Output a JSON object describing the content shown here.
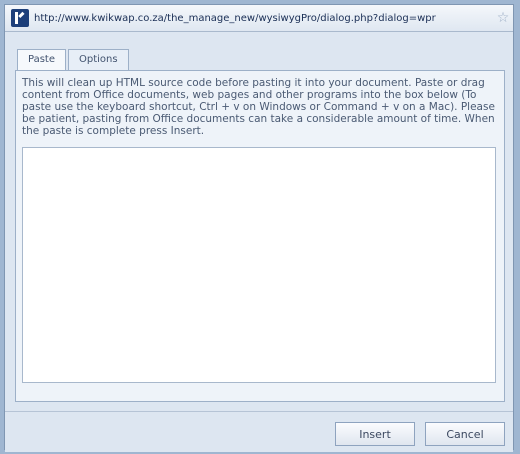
{
  "window": {
    "url": "http://www.kwikwap.co.za/the_manage_new/wysiwygPro/dialog.php?dialog=wpr"
  },
  "tabs": [
    {
      "label": "Paste",
      "active": true
    },
    {
      "label": "Options",
      "active": false
    }
  ],
  "panel": {
    "instructions": "This will clean up HTML source code before pasting it into your document. Paste or drag content from Office documents, web pages and other programs into the box below (To paste use the keyboard shortcut, Ctrl + v on Windows or Command + v on a Mac). Please be patient, pasting from Office documents can take a considerable amount of time. When the paste is complete press Insert."
  },
  "buttons": {
    "insert": "Insert",
    "cancel": "Cancel"
  },
  "icons": {
    "app": "wysiwygpro-logo-icon",
    "bookmark": "star-icon"
  },
  "colors": {
    "frame": "#9fb6d1",
    "panel": "#eef3f9"
  }
}
